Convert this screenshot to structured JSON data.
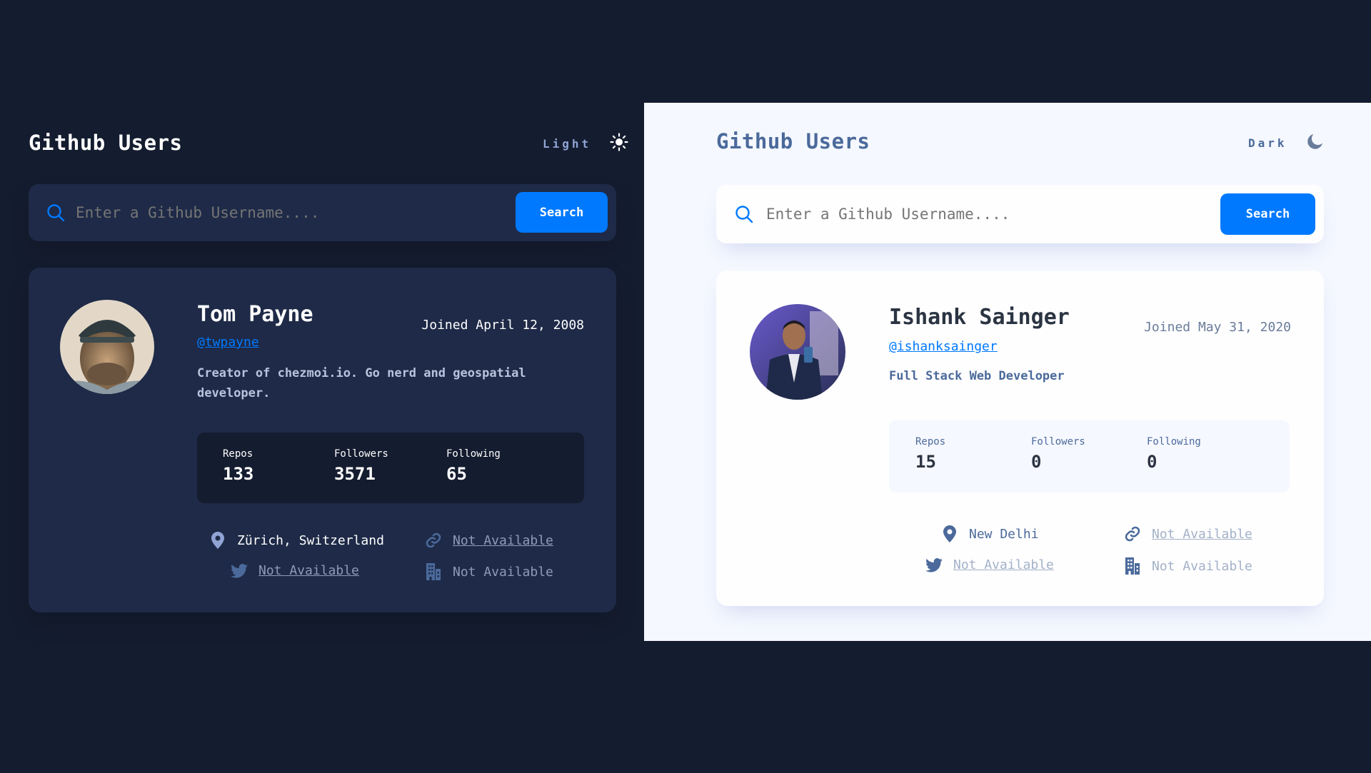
{
  "dark_panel": {
    "title": "Github Users",
    "mode_label": "Light",
    "mode_icon": "sun-icon",
    "search": {
      "placeholder": "Enter a Github Username....",
      "button_label": "Search"
    },
    "profile": {
      "name": "Tom Payne",
      "handle": "@twpayne",
      "joined": "Joined April 12, 2008",
      "bio": "Creator of chezmoi.io. Go nerd and geospatial developer.",
      "stats": [
        {
          "label": "Repos",
          "value": "133"
        },
        {
          "label": "Followers",
          "value": "3571"
        },
        {
          "label": "Following",
          "value": "65"
        }
      ],
      "location": "Zürich, Switzerland",
      "website": "Not Available",
      "twitter": "Not Available",
      "company": "Not Available"
    }
  },
  "light_panel": {
    "title": "Github Users",
    "mode_label": "Dark",
    "mode_icon": "moon-icon",
    "search": {
      "placeholder": "Enter a Github Username....",
      "button_label": "Search"
    },
    "profile": {
      "name": "Ishank Sainger",
      "handle": "@ishanksainger",
      "joined": "Joined May 31, 2020",
      "bio": "Full Stack Web Developer",
      "stats": [
        {
          "label": "Repos",
          "value": "15"
        },
        {
          "label": "Followers",
          "value": "0"
        },
        {
          "label": "Following",
          "value": "0"
        }
      ],
      "location": "New Delhi",
      "website": "Not Available",
      "twitter": "Not Available",
      "company": "Not Available"
    }
  },
  "colors": {
    "accent": "#0079ff",
    "dark_bg": "#141c2f",
    "dark_card": "#1e2a47",
    "light_bg": "#f5f8ff",
    "light_card": "#fefefe"
  }
}
